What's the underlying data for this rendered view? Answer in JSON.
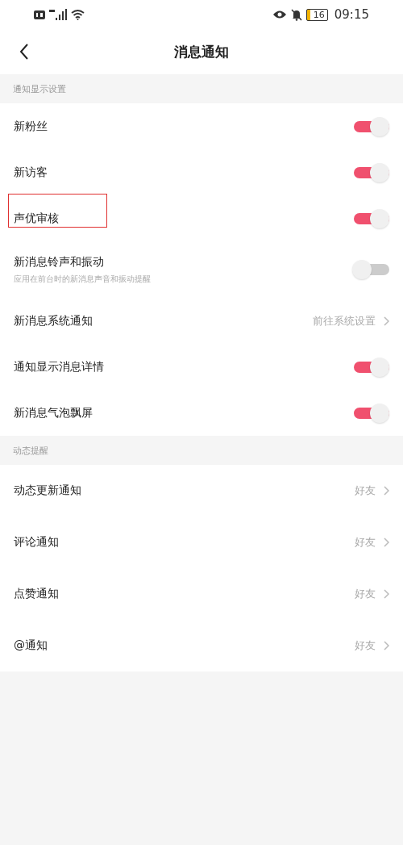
{
  "status_bar": {
    "battery": "16",
    "time": "09:15"
  },
  "header": {
    "title": "消息通知"
  },
  "sections": [
    {
      "title": "通知显示设置",
      "items": [
        {
          "kind": "toggle",
          "label": "新粉丝",
          "on": true,
          "highlighted": false
        },
        {
          "kind": "toggle",
          "label": "新访客",
          "on": true,
          "highlighted": false
        },
        {
          "kind": "toggle",
          "label": "声优审核",
          "on": true,
          "highlighted": true
        },
        {
          "kind": "toggle",
          "label": "新消息铃声和振动",
          "subtitle": "应用在前台时的新消息声音和振动提醒",
          "on": false,
          "highlighted": false
        },
        {
          "kind": "link",
          "label": "新消息系统通知",
          "value": "前往系统设置",
          "highlighted": false
        },
        {
          "kind": "toggle",
          "label": "通知显示消息详情",
          "on": true,
          "highlighted": false
        },
        {
          "kind": "toggle",
          "label": "新消息气泡飘屏",
          "on": true,
          "highlighted": false
        }
      ]
    },
    {
      "title": "动态提醒",
      "items": [
        {
          "kind": "link",
          "label": "动态更新通知",
          "value": "好友",
          "highlighted": false
        },
        {
          "kind": "link",
          "label": "评论通知",
          "value": "好友",
          "highlighted": false
        },
        {
          "kind": "link",
          "label": "点赞通知",
          "value": "好友",
          "highlighted": false
        },
        {
          "kind": "link",
          "label": "@通知",
          "value": "好友",
          "highlighted": false
        }
      ]
    }
  ]
}
